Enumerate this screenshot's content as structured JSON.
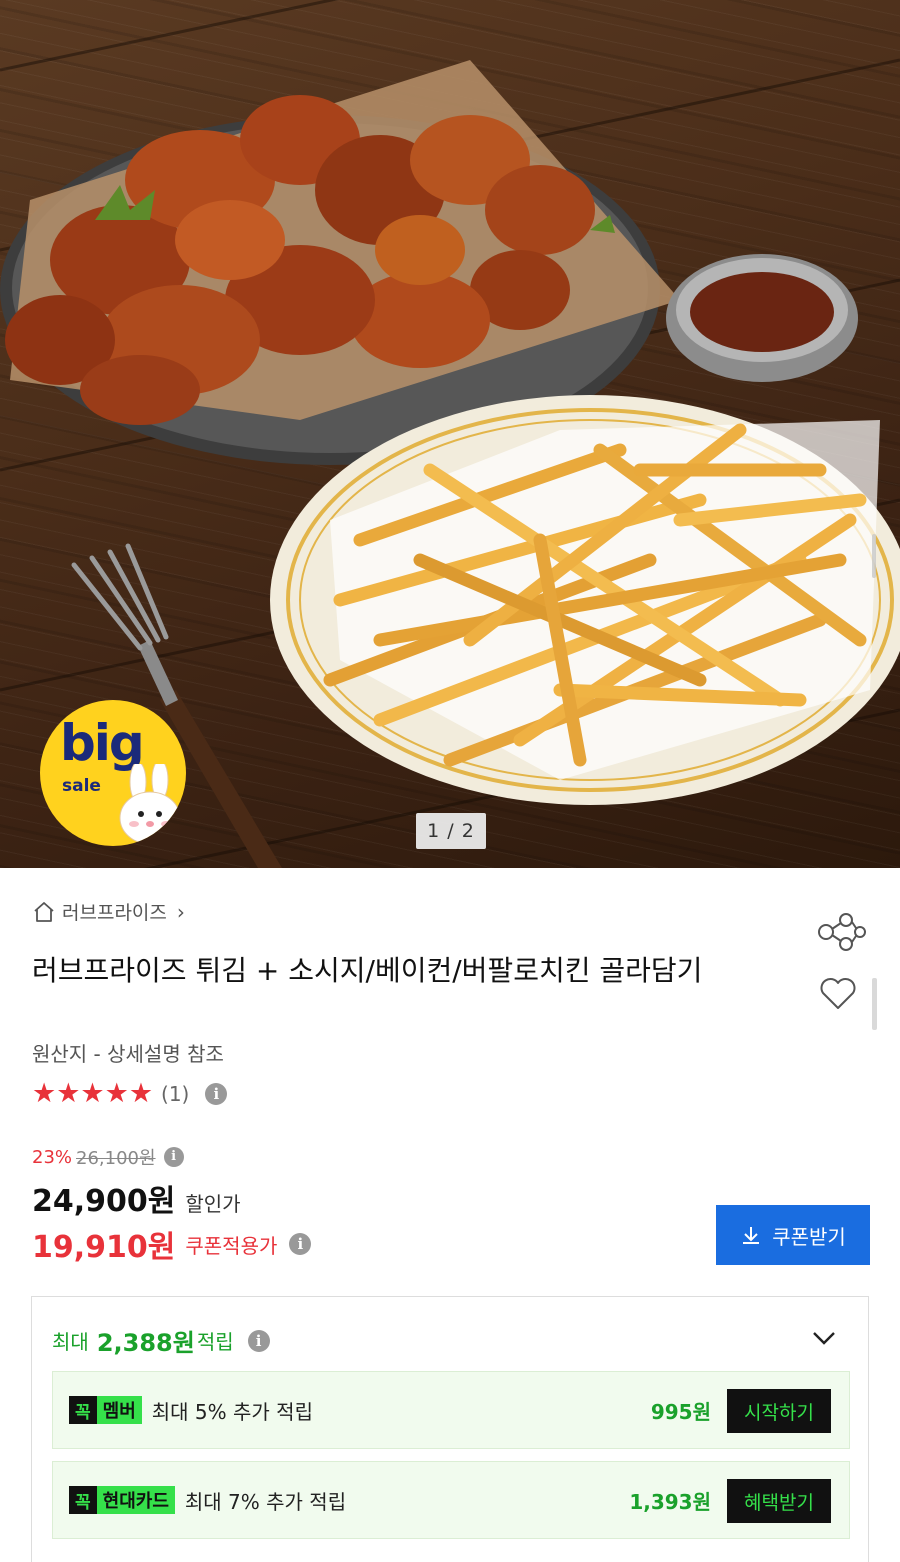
{
  "hero": {
    "pager": "1 / 2",
    "badge_big": "big",
    "badge_sale": "sale"
  },
  "product": {
    "brand": "러브프라이즈",
    "title": "러브프라이즈 튀김 + 소시지/베이컨/버팔로치킨 골라담기",
    "origin": "원산지 - 상세설명 참조",
    "stars": "★★★★★",
    "rating_count": "(1)"
  },
  "price": {
    "discount_rate": "23%",
    "original_price": "26,100원",
    "sale_price": "24,900원",
    "sale_label": "할인가",
    "coupon_price": "19,910원",
    "coupon_label": "쿠폰적용가",
    "coupon_button": "쿠폰받기"
  },
  "points": {
    "prefix": "최대",
    "amount": "2,388원",
    "suffix": "적립",
    "benefits": [
      {
        "badge_k": "꼭",
        "badge_name": "멤버",
        "desc": "최대 5% 추가 적립",
        "points": "995원",
        "action": "시작하기"
      },
      {
        "badge_k": "꼭",
        "badge_name": "현대카드",
        "desc": "최대 7% 추가 적립",
        "points": "1,393원",
        "action": "혜택받기"
      }
    ]
  },
  "colors": {
    "accent_red": "#e8323a",
    "accent_blue": "#1a6de0",
    "accent_green": "#1aa12b",
    "member_green": "#35e04a"
  },
  "icons": [
    "home-icon",
    "chevron-right-icon",
    "share-icon",
    "heart-icon",
    "info-icon",
    "download-icon",
    "chevron-down-icon"
  ]
}
